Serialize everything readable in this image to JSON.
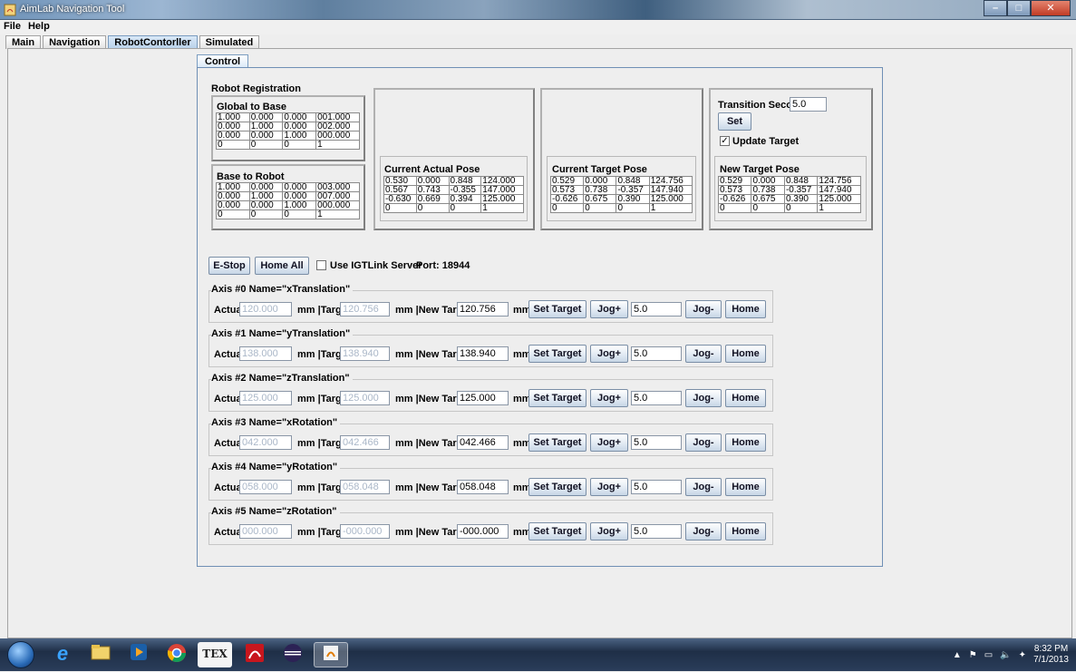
{
  "window": {
    "title": "AimLab Navigation Tool"
  },
  "menu": {
    "file": "File",
    "help": "Help"
  },
  "tabs": [
    "Main",
    "Navigation",
    "RobotContorller",
    "Simulated"
  ],
  "control_tab": "Control",
  "registration": {
    "title": "Robot Registration",
    "global_to_base": {
      "label": "Global to Base",
      "rows": [
        [
          "1.000",
          "0.000",
          "0.000",
          "001.000"
        ],
        [
          "0.000",
          "1.000",
          "0.000",
          "002.000"
        ],
        [
          "0.000",
          "0.000",
          "1.000",
          "000.000"
        ],
        [
          "0",
          "0",
          "0",
          "1"
        ]
      ]
    },
    "base_to_robot": {
      "label": "Base to Robot",
      "rows": [
        [
          "1.000",
          "0.000",
          "0.000",
          "003.000"
        ],
        [
          "0.000",
          "1.000",
          "0.000",
          "007.000"
        ],
        [
          "0.000",
          "0.000",
          "1.000",
          "000.000"
        ],
        [
          "0",
          "0",
          "0",
          "1"
        ]
      ]
    }
  },
  "current_actual": {
    "label": "Current Actual Pose",
    "rows": [
      [
        "0.530",
        "0.000",
        "0.848",
        "124.000"
      ],
      [
        "0.567",
        "0.743",
        "-0.355",
        "147.000"
      ],
      [
        "-0.630",
        "0.669",
        "0.394",
        "125.000"
      ],
      [
        "0",
        "0",
        "0",
        "1"
      ]
    ]
  },
  "current_target": {
    "label": "Current Target Pose",
    "rows": [
      [
        "0.529",
        "0.000",
        "0.848",
        "124.756"
      ],
      [
        "0.573",
        "0.738",
        "-0.357",
        "147.940"
      ],
      [
        "-0.626",
        "0.675",
        "0.390",
        "125.000"
      ],
      [
        "0",
        "0",
        "0",
        "1"
      ]
    ]
  },
  "new_target": {
    "label": "New Target Pose",
    "rows": [
      [
        "0.529",
        "0.000",
        "0.848",
        "124.756"
      ],
      [
        "0.573",
        "0.738",
        "-0.357",
        "147.940"
      ],
      [
        "-0.626",
        "0.675",
        "0.390",
        "125.000"
      ],
      [
        "0",
        "0",
        "0",
        "1"
      ]
    ]
  },
  "transition": {
    "label": "Transition Seconds",
    "value": "5.0",
    "set_label": "Set",
    "update_target_label": "Update Target",
    "update_target_checked": true
  },
  "controls": {
    "estop": "E-Stop",
    "home_all": "Home All",
    "igtlink_label": "Use IGTLink Server",
    "port_label": "Port: 18944"
  },
  "axis_labels": {
    "actual": "Actual",
    "mm_target": "mm |Target",
    "mm_new_target": "mm |New Target",
    "mm": "mm",
    "set_target": "Set Target",
    "jog_plus": "Jog+",
    "jog_minus": "Jog-",
    "home": "Home"
  },
  "axes": [
    {
      "title": "Axis #0 Name=\"xTranslation\"",
      "actual": "120.000",
      "target": "120.756",
      "new_target": "120.756",
      "jog": "5.0"
    },
    {
      "title": "Axis #1 Name=\"yTranslation\"",
      "actual": "138.000",
      "target": "138.940",
      "new_target": "138.940",
      "jog": "5.0"
    },
    {
      "title": "Axis #2 Name=\"zTranslation\"",
      "actual": "125.000",
      "target": "125.000",
      "new_target": "125.000",
      "jog": "5.0"
    },
    {
      "title": "Axis #3 Name=\"xRotation\"",
      "actual": "042.000",
      "target": "042.466",
      "new_target": "042.466",
      "jog": "5.0"
    },
    {
      "title": "Axis #4 Name=\"yRotation\"",
      "actual": "058.000",
      "target": "058.048",
      "new_target": "058.048",
      "jog": "5.0"
    },
    {
      "title": "Axis #5 Name=\"zRotation\"",
      "actual": "000.000",
      "target": "-000.000",
      "new_target": "-000.000",
      "jog": "5.0"
    }
  ],
  "taskbar": {
    "clock_time": "8:32 PM",
    "clock_date": "7/1/2013",
    "tex_label": "TEX"
  }
}
